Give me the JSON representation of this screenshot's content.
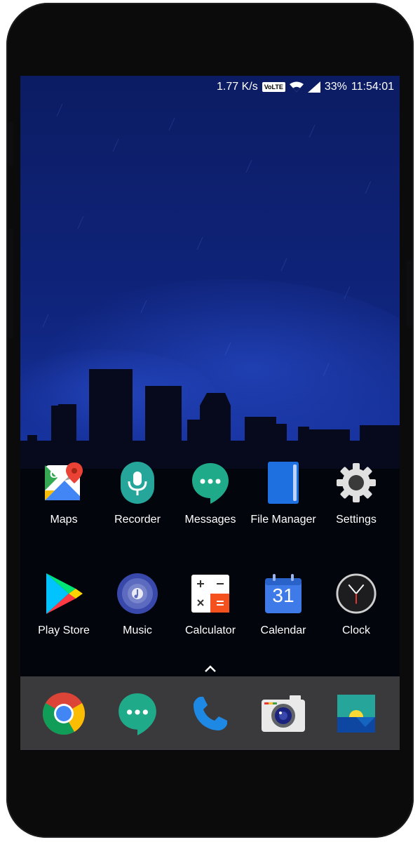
{
  "status_bar": {
    "speed": "1.77 K/s",
    "volte": "VoLTE",
    "battery": "33%",
    "time": "11:54:01"
  },
  "apps_row1": [
    {
      "label": "Maps",
      "icon": "maps-icon"
    },
    {
      "label": "Recorder",
      "icon": "recorder-icon"
    },
    {
      "label": "Messages",
      "icon": "messages-icon"
    },
    {
      "label": "File Manager",
      "icon": "file-manager-icon"
    },
    {
      "label": "Settings",
      "icon": "settings-icon"
    }
  ],
  "apps_row2": [
    {
      "label": "Play Store",
      "icon": "play-store-icon"
    },
    {
      "label": "Music",
      "icon": "music-icon"
    },
    {
      "label": "Calculator",
      "icon": "calculator-icon"
    },
    {
      "label": "Calendar",
      "icon": "calendar-icon",
      "badge": "31"
    },
    {
      "label": "Clock",
      "icon": "clock-icon"
    }
  ],
  "dock": [
    {
      "icon": "chrome-icon"
    },
    {
      "icon": "hangouts-icon"
    },
    {
      "icon": "phone-icon"
    },
    {
      "icon": "camera-icon"
    },
    {
      "icon": "gallery-icon"
    }
  ],
  "colors": {
    "wallpaper_top": "#0d1e66",
    "wallpaper_mid": "#152e9c",
    "dock_bg": "#3a393b"
  }
}
